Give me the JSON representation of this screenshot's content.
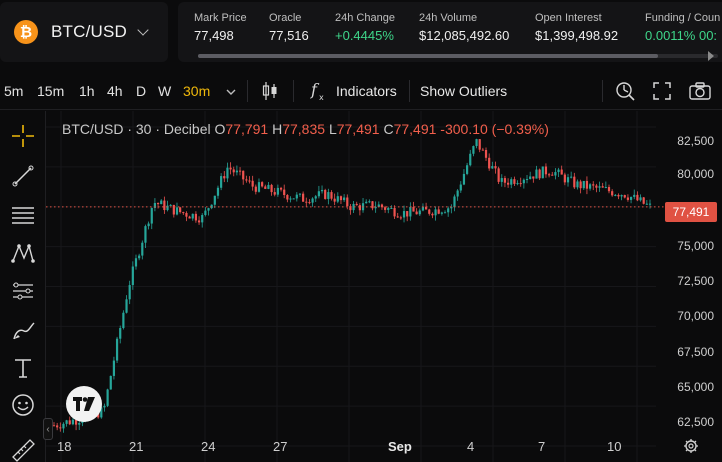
{
  "pair": {
    "symbol": "BTC/USD",
    "logo_glyph": "₿",
    "logo_color": "#f7931a"
  },
  "stats": [
    {
      "label": "Mark Price",
      "value": "77,498"
    },
    {
      "label": "Oracle",
      "value": "77,516"
    },
    {
      "label": "24h Change",
      "value": "+0.4445%"
    },
    {
      "label": "24h Volume",
      "value": "$12,085,492.60"
    },
    {
      "label": "Open Interest",
      "value": "$1,399,498.92"
    },
    {
      "label": "Funding / Coun",
      "value": "0.0011% 00:"
    }
  ],
  "toolbar": {
    "timeframes": [
      "5m",
      "15m",
      "1h",
      "4h",
      "D",
      "W",
      "30m"
    ],
    "active_timeframe": "30m",
    "indicators_label": "Indicators",
    "outliers_label": "Show Outliers"
  },
  "legend": {
    "symbol": "BTC/USD · 30 · Decibel",
    "open_key": "O",
    "open": "77,791",
    "high_key": "H",
    "high": "77,835",
    "low_key": "L",
    "low": "77,491",
    "close_key": "C",
    "close": "77,491",
    "change": "-300.10 (−0.39%)"
  },
  "last_price_tag": "77,491",
  "y_axis": [
    "82,500",
    "80,000",
    "77,500",
    "75,000",
    "72,500",
    "70,000",
    "67,500",
    "65,000",
    "62,500"
  ],
  "x_axis": [
    "18",
    "21",
    "24",
    "27",
    "Sep",
    "4",
    "7",
    "10"
  ],
  "colors": {
    "up": "#26a69a",
    "down": "#ef5350",
    "accent": "#f0b90b",
    "green_text": "#3ed68a",
    "price_tag": "#e05243"
  },
  "chart_data": {
    "type": "line",
    "x": [
      "18",
      "19",
      "20",
      "21",
      "22",
      "23",
      "24",
      "25",
      "26",
      "27",
      "28",
      "29",
      "30",
      "31",
      "Sep",
      "2",
      "3",
      "4",
      "5",
      "6",
      "7",
      "8",
      "9",
      "10",
      "11"
    ],
    "series": [
      {
        "values": [
          63800,
          64200,
          64700,
          72500,
          77800,
          77200,
          76800,
          80000,
          78800,
          78400,
          78000,
          78300,
          77500,
          77600,
          77100,
          77200,
          77500,
          81600,
          79000,
          79400,
          79800,
          78900,
          78600,
          78300,
          77491
        ]
      }
    ],
    "ylim": [
      61500,
      83500
    ],
    "last_price": 77491
  }
}
